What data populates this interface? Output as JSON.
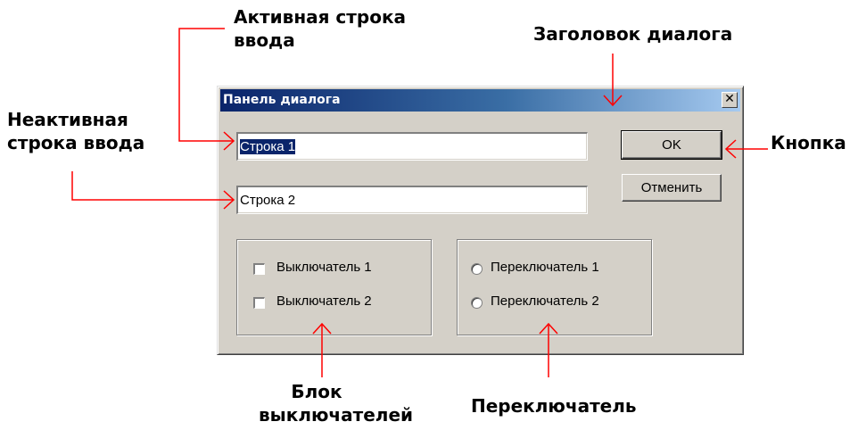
{
  "annotations": {
    "active_input": [
      "Активная строка",
      "ввода"
    ],
    "inactive_input": [
      "Неактивная",
      "строка ввода"
    ],
    "dialog_title": "Заголовок диалога",
    "button": "Кнопка",
    "checkbox_block": [
      "Блок",
      "выключателей"
    ],
    "radio": "Переключатель"
  },
  "dialog": {
    "title": "Панель диалога",
    "close_glyph": "✕",
    "input1": "Строка 1",
    "input2": "Строка 2",
    "ok_label": "OK",
    "cancel_label": "Отменить",
    "checkboxes": [
      "Выключатель 1",
      "Выключатель 2"
    ],
    "radios": [
      "Переключатель 1",
      "Переключатель 2"
    ]
  },
  "colors": {
    "arrow": "#ff0000",
    "dialog_bg": "#d4d0c8",
    "title_start": "#0a246a",
    "title_end": "#a6caf0"
  }
}
